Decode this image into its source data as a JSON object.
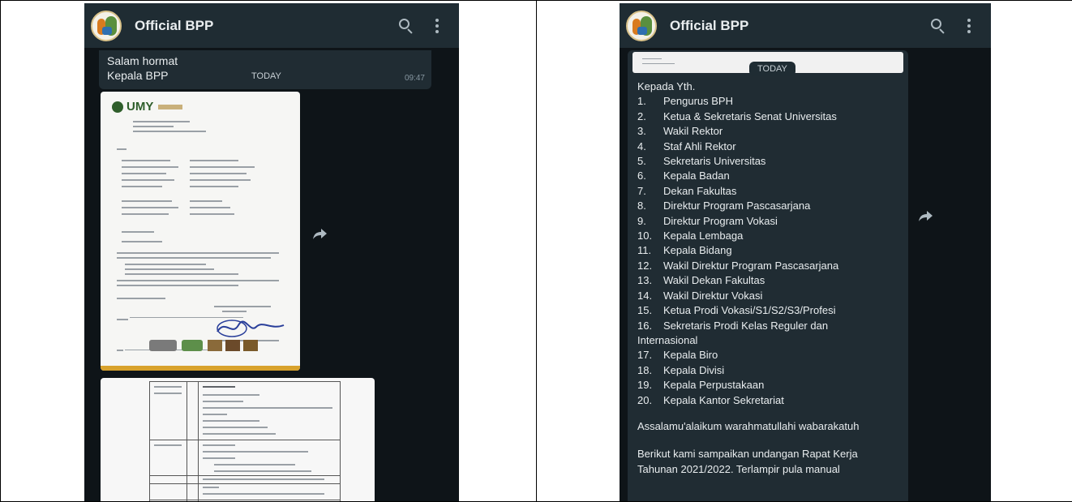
{
  "left": {
    "appbar": {
      "title": "Official BPP"
    },
    "message": {
      "lines": [
        "Salam hormat",
        "Kepala BPP"
      ],
      "day_label": "TODAY",
      "time": "09:47"
    },
    "letter_image": {
      "org_logo_text": "UMY"
    }
  },
  "right": {
    "appbar": {
      "title": "Official BPP"
    },
    "day_label": "TODAY",
    "message": {
      "greeting": "Kepada Yth.",
      "recipients": [
        {
          "num": "1.",
          "text": "Pengurus BPH"
        },
        {
          "num": "2.",
          "text": "Ketua & Sekretaris Senat Universitas"
        },
        {
          "num": "3.",
          "text": "Wakil Rektor"
        },
        {
          "num": "4.",
          "text": "Staf Ahli Rektor"
        },
        {
          "num": "5.",
          "text": "Sekretaris Universitas"
        },
        {
          "num": "6.",
          "text": "Kepala Badan"
        },
        {
          "num": "7.",
          "text": "Dekan Fakultas"
        },
        {
          "num": "8.",
          "text": "Direktur Program Pascasarjana"
        },
        {
          "num": "9.",
          "text": "Direktur Program Vokasi"
        },
        {
          "num": "10.",
          "text": "Kepala Lembaga"
        },
        {
          "num": "11.",
          "text": "Kepala Bidang"
        },
        {
          "num": "12.",
          "text": "Wakil Direktur Program Pascasarjana"
        },
        {
          "num": "13.",
          "text": "Wakil Dekan Fakultas"
        },
        {
          "num": "14.",
          "text": "Wakil Direktur Vokasi"
        },
        {
          "num": "15.",
          "text": "Ketua Prodi Vokasi/S1/S2/S3/Profesi"
        },
        {
          "num": "16.",
          "text": "Sekretaris Prodi Kelas Reguler dan"
        }
      ],
      "recipient_16_cont": "Internasional",
      "recipients_2": [
        {
          "num": "17.",
          "text": "Kepala Biro"
        },
        {
          "num": "18.",
          "text": "Kepala Divisi"
        },
        {
          "num": "19.",
          "text": "Kepala Perpustakaan"
        },
        {
          "num": "20.",
          "text": "Kepala Kantor Sekretariat"
        }
      ],
      "salam": "Assalamu'alaikum warahmatullahi wabarakatuh",
      "body_1": "Berikut kami sampaikan undangan Rapat Kerja",
      "body_2": "Tahunan 2021/2022. Terlampir pula manual"
    }
  },
  "colors": {
    "chat_bg": "#0e1418",
    "appbar": "#1f2c33",
    "bubble": "#202c33",
    "text": "#e9edef",
    "muted": "#8696a0"
  }
}
